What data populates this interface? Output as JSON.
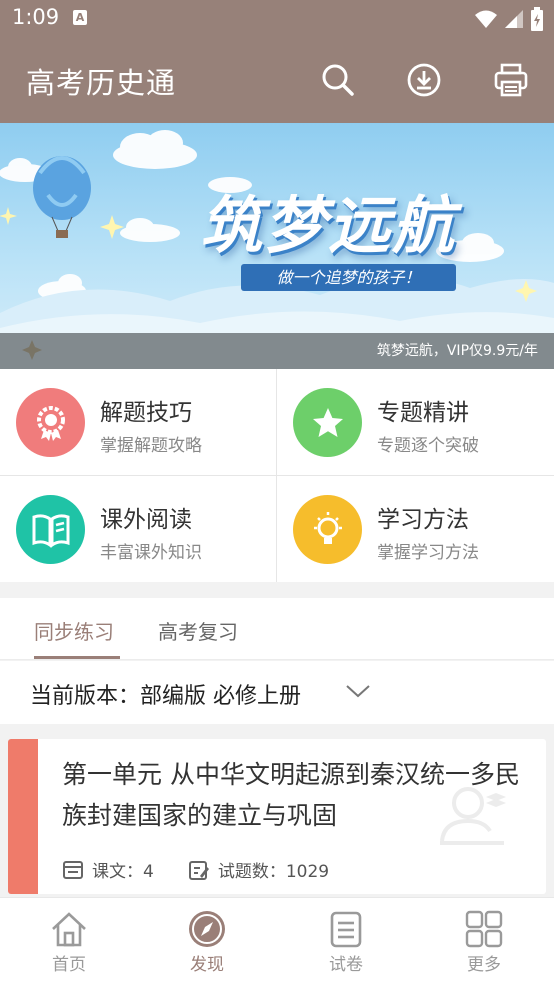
{
  "status_bar": {
    "time": "1:09",
    "notification_icon": "text-a-icon"
  },
  "app_bar": {
    "title": "高考历史通",
    "actions": [
      "search-icon",
      "download-icon",
      "print-icon"
    ]
  },
  "banner": {
    "title": "筑梦远航",
    "subtitle": "做一个追梦的孩子！",
    "caption": "筑梦远航，VIP仅9.9元/年"
  },
  "features": [
    {
      "title": "解题技巧",
      "subtitle": "掌握解题攻略",
      "color": "#f07c7c",
      "icon": "award-icon"
    },
    {
      "title": "专题精讲",
      "subtitle": "专题逐个突破",
      "color": "#6dcf6a",
      "icon": "star-icon"
    },
    {
      "title": "课外阅读",
      "subtitle": "丰富课外知识",
      "color": "#1fc3a6",
      "icon": "book-icon"
    },
    {
      "title": "学习方法",
      "subtitle": "掌握学习方法",
      "color": "#f6bd2c",
      "icon": "lightbulb-icon"
    }
  ],
  "tabs": [
    {
      "label": "同步练习",
      "active": true
    },
    {
      "label": "高考复习",
      "active": false
    }
  ],
  "version": {
    "label": "当前版本：部编版 必修上册"
  },
  "unit_card": {
    "title": "第一单元 从中华文明起源到秦汉统一多民族封建国家的建立与巩固",
    "lessons_label": "课文：4",
    "questions_label": "试题数：1029",
    "accent": "#ef7b6a"
  },
  "bottom_nav": [
    {
      "label": "首页",
      "icon": "home-icon",
      "active": false
    },
    {
      "label": "发现",
      "icon": "compass-icon",
      "active": true
    },
    {
      "label": "试卷",
      "icon": "paper-icon",
      "active": false
    },
    {
      "label": "更多",
      "icon": "grid-icon",
      "active": false
    }
  ],
  "colors": {
    "primary": "#978179",
    "active_nav": "#9a7f78",
    "inactive_nav": "#9a9a9a"
  }
}
